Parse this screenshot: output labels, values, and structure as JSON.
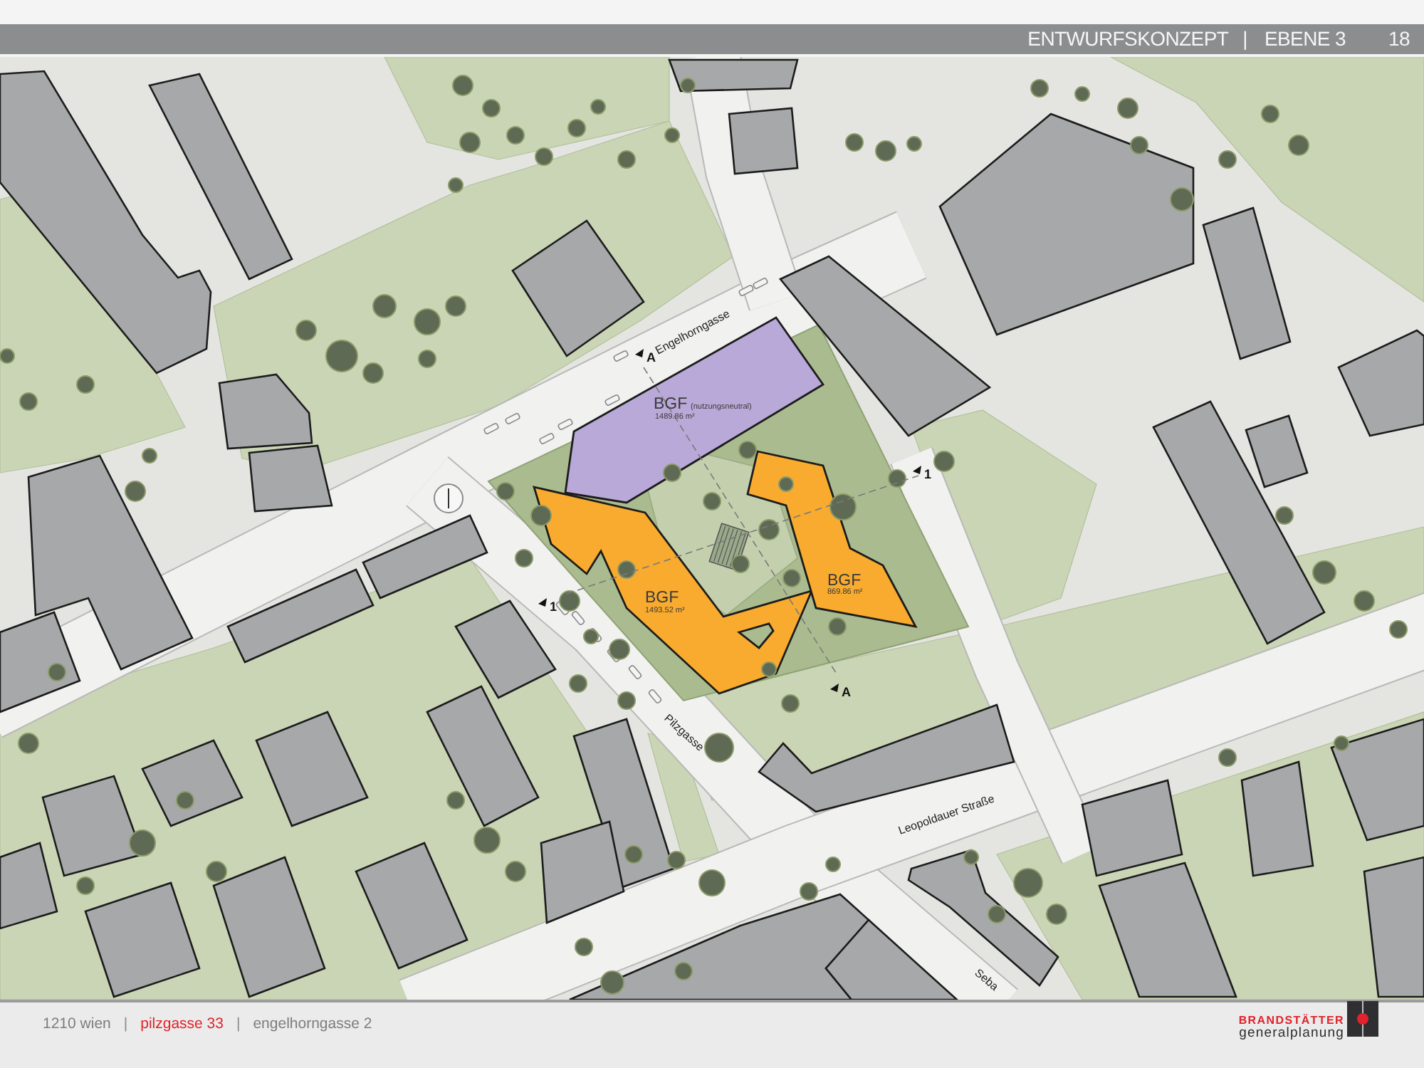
{
  "header": {
    "title": "ENTWURFSKONZEPT",
    "separator": "|",
    "subtitle": "EBENE 3",
    "page": "18"
  },
  "site_plan": {
    "streets": [
      {
        "name": "Engelhorngasse"
      },
      {
        "name": "Pilzgasse"
      },
      {
        "name": "Leopoldauer Straße"
      },
      {
        "name": "Seba"
      }
    ],
    "areas": [
      {
        "label": "BGF",
        "note": "(nutzungsneutral)",
        "value": "1489.86 m²",
        "color": "#b9a9d8"
      },
      {
        "label": "BGF",
        "value": "1493.52 m²",
        "color": "#f8ab2e"
      },
      {
        "label": "BGF",
        "value": "869.86 m²",
        "color": "#f8ab2e"
      }
    ],
    "section_markers": [
      {
        "label": "A"
      },
      {
        "label": "1"
      },
      {
        "label": "1"
      },
      {
        "label": "A"
      }
    ]
  },
  "footer": {
    "parts": [
      {
        "kind": "text",
        "text": "1210 wien",
        "highlighted": false
      },
      {
        "kind": "separator",
        "text": "|"
      },
      {
        "kind": "text",
        "text": "pilzgasse 33",
        "highlighted": true
      },
      {
        "kind": "separator",
        "text": "|"
      },
      {
        "kind": "text",
        "text": "engelhorngasse 2",
        "highlighted": false
      }
    ]
  },
  "logo": {
    "name": "BRANDSTÄTTER",
    "tagline": "generalplanung"
  }
}
